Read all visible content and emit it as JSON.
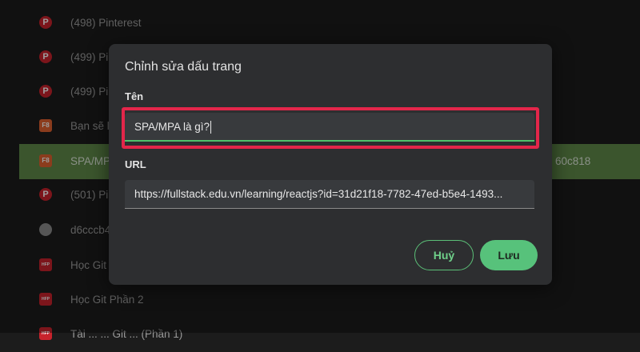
{
  "bookmarks": [
    {
      "label": "(498) Pinterest",
      "icon": "pinterest-icon"
    },
    {
      "label": "(499) Pi",
      "icon": "pinterest-icon"
    },
    {
      "label": "(499) Pi",
      "icon": "pinterest-icon"
    },
    {
      "label": "Bạn sẽ l",
      "icon": "f8-icon",
      "icon_text": "F8"
    },
    {
      "label": "SPA/MP",
      "icon": "f8-icon",
      "icon_text": "F8",
      "selected": true,
      "trail": "60c818"
    },
    {
      "label": "(501) Pi",
      "icon": "pinterest-icon"
    },
    {
      "label": "d6cccb4",
      "icon": "globe-icon"
    },
    {
      "label": "Học Git",
      "icon": "hfp-icon",
      "icon_text": "HFP"
    },
    {
      "label": "Học Git Phần 2",
      "icon": "hfp-icon",
      "icon_text": "HFP"
    },
    {
      "label": "Tài ... ... Git ... (Phần 1)",
      "icon": "hfp-icon",
      "icon_text": "HFP"
    }
  ],
  "dialog": {
    "title": "Chỉnh sửa dấu trang",
    "name_label": "Tên",
    "name_value": "SPA/MPA là gì?",
    "url_label": "URL",
    "url_value": "https://fullstack.edu.vn/learning/reactjs?id=31d21f18-7782-47ed-b5e4-1493...",
    "cancel_label": "Huỷ",
    "save_label": "Lưu"
  },
  "colors": {
    "accent": "#57c27b",
    "highlight": "#e3264a",
    "selected_row": "#5f8a4a",
    "pinterest": "#c8232c",
    "f8": "#e0622f"
  }
}
